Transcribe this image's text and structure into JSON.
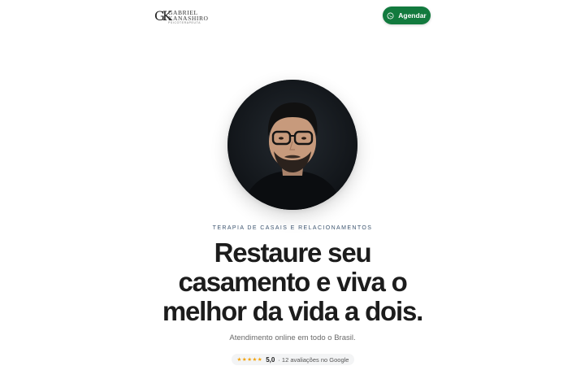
{
  "header": {
    "logo": {
      "monogram": "GK",
      "name_line1": "GABRIEL",
      "name_line2": "KANASHIRO",
      "tagline": "PSICOTERAPEUTA"
    },
    "cta_label": "Agendar",
    "cta_icon": "whatsapp-icon",
    "cta_color": "#127a3e"
  },
  "hero": {
    "eyebrow": "TERAPIA DE CASAIS E RELACIONAMENTOS",
    "headline_lines": [
      "Restaure seu",
      "casamento e viva o",
      "melhor da vida a dois."
    ],
    "subline": "Atendimento online em todo o Brasil.",
    "rating": {
      "stars": "★★★★★",
      "stars_count": 5,
      "score": "5,0",
      "text": "· 12 avaliações no Google"
    }
  }
}
